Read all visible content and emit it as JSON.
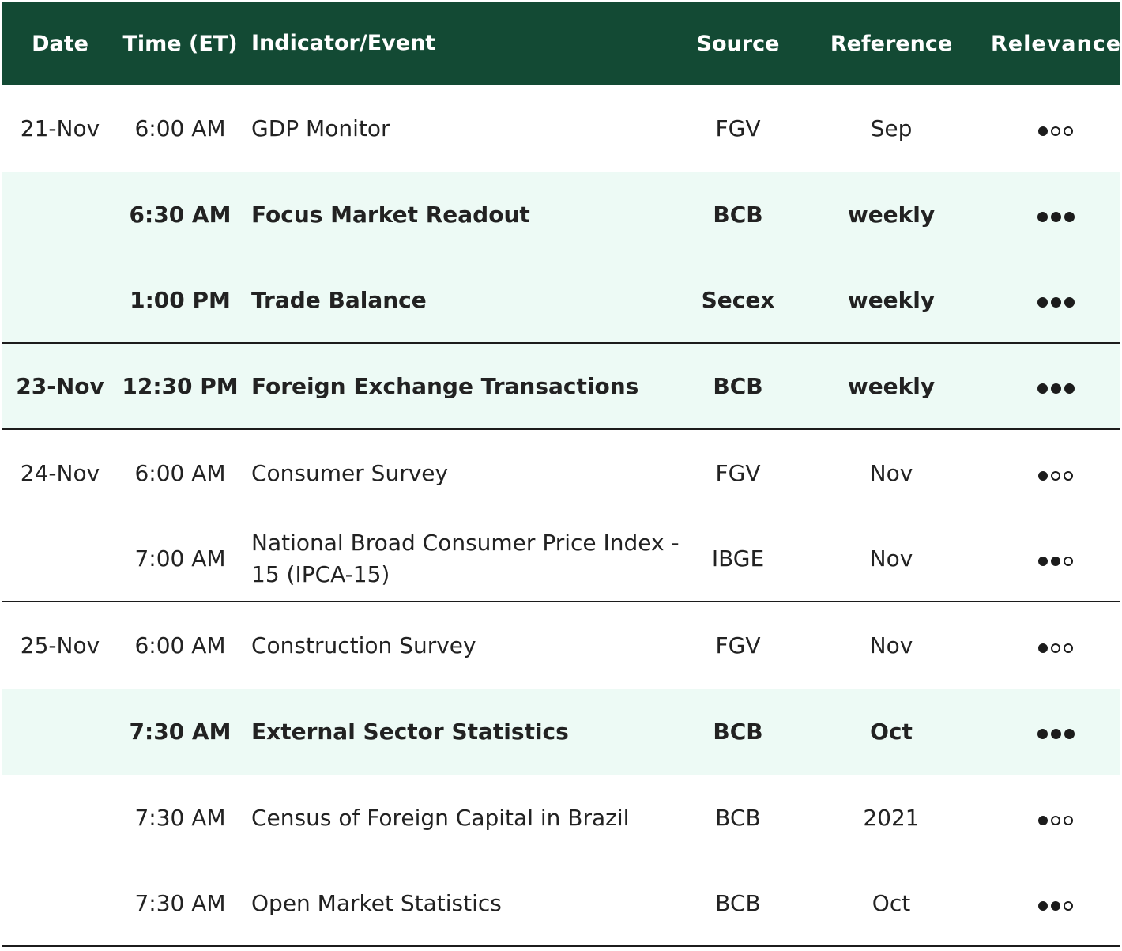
{
  "header": {
    "date": "Date",
    "time": "Time (ET)",
    "indicator": "Indicator/Event",
    "source": "Source",
    "reference": "Reference",
    "relevance": "Relevance"
  },
  "colors": {
    "header_bg": "#134a34",
    "highlight_bg": "#edfaf5",
    "text": "#222222"
  },
  "rows": [
    {
      "date": "21-Nov",
      "time": "6:00 AM",
      "indicator": "GDP Monitor",
      "source": "FGV",
      "reference": "Sep",
      "relevance": 1,
      "highlight": false,
      "bold": false,
      "separator": false
    },
    {
      "date": "",
      "time": "6:30 AM",
      "indicator": "Focus Market Readout",
      "source": "BCB",
      "reference": "weekly",
      "relevance": 3,
      "highlight": true,
      "bold": true,
      "separator": false
    },
    {
      "date": "",
      "time": "1:00 PM",
      "indicator": "Trade Balance",
      "source": "Secex",
      "reference": "weekly",
      "relevance": 3,
      "highlight": true,
      "bold": true,
      "separator": true
    },
    {
      "date": "23-Nov",
      "time": "12:30 PM",
      "indicator": "Foreign Exchange Transactions",
      "source": "BCB",
      "reference": "weekly",
      "relevance": 3,
      "highlight": true,
      "bold": true,
      "separator": true
    },
    {
      "date": "24-Nov",
      "time": "6:00 AM",
      "indicator": "Consumer Survey",
      "source": "FGV",
      "reference": "Nov",
      "relevance": 1,
      "highlight": false,
      "bold": false,
      "separator": false
    },
    {
      "date": "",
      "time": "7:00 AM",
      "indicator": "National Broad Consumer Price Index - 15 (IPCA-15)",
      "source": "IBGE",
      "reference": "Nov",
      "relevance": 2,
      "highlight": false,
      "bold": false,
      "separator": true
    },
    {
      "date": "25-Nov",
      "time": "6:00 AM",
      "indicator": "Construction Survey",
      "source": "FGV",
      "reference": "Nov",
      "relevance": 1,
      "highlight": false,
      "bold": false,
      "separator": false
    },
    {
      "date": "",
      "time": "7:30 AM",
      "indicator": "External Sector Statistics",
      "source": "BCB",
      "reference": "Oct",
      "relevance": 3,
      "highlight": true,
      "bold": true,
      "separator": false
    },
    {
      "date": "",
      "time": "7:30 AM",
      "indicator": "Census of Foreign Capital in Brazil",
      "source": "BCB",
      "reference": "2021",
      "relevance": 1,
      "highlight": false,
      "bold": false,
      "separator": false
    },
    {
      "date": "",
      "time": "7:30 AM",
      "indicator": "Open Market Statistics",
      "source": "BCB",
      "reference": "Oct",
      "relevance": 2,
      "highlight": false,
      "bold": false,
      "separator": true
    }
  ]
}
